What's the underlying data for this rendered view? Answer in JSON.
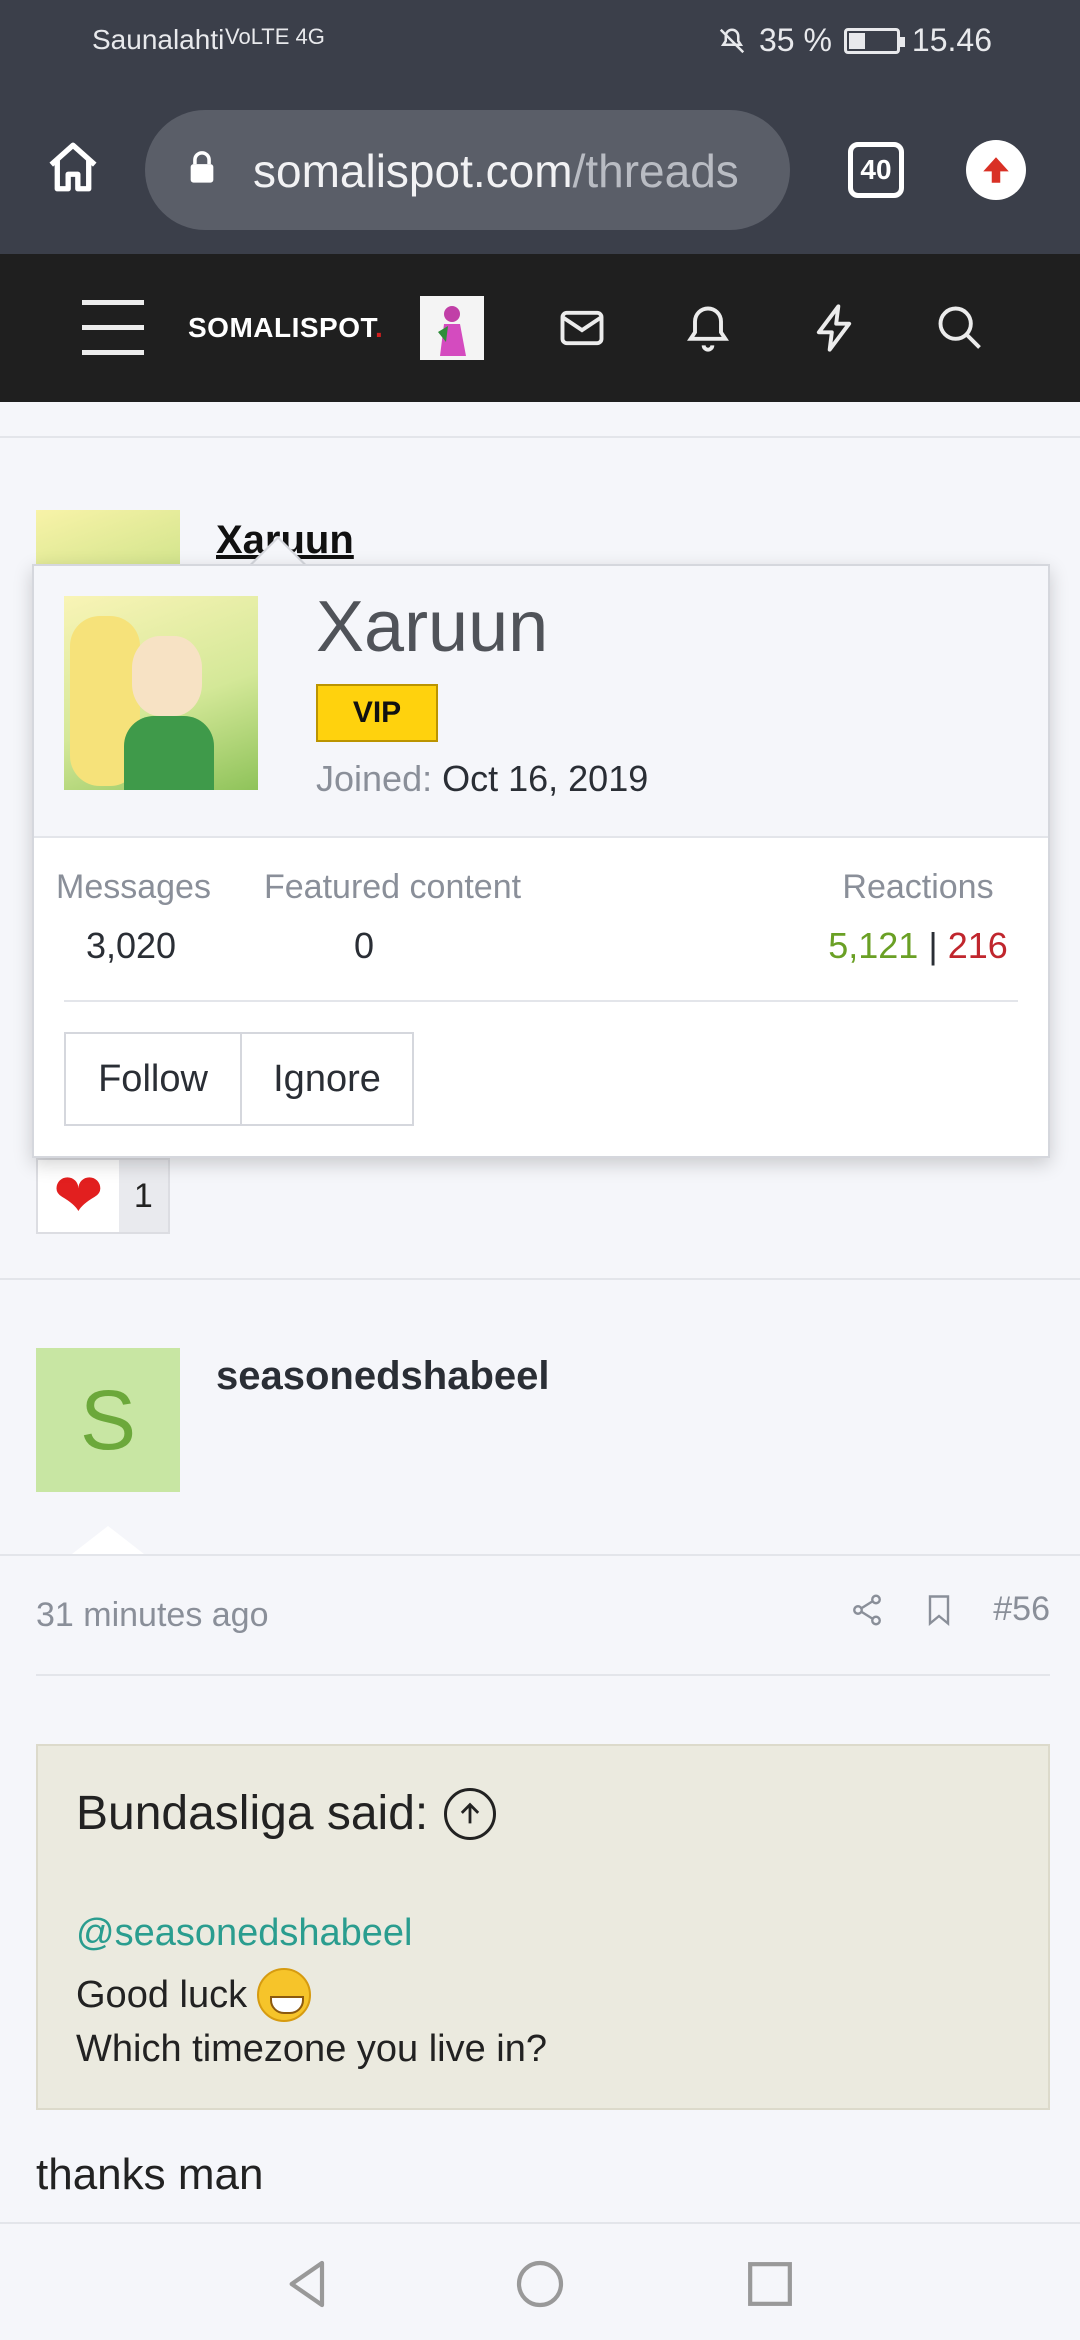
{
  "status_bar": {
    "carrier": "Saunalahti",
    "indicators": "VoLTE 4G",
    "battery": "35 %",
    "battery_level": 0.35,
    "time": "15.46"
  },
  "browser": {
    "url_host": "somalispot.com",
    "url_path": "/threads",
    "tab_count": "40"
  },
  "site_nav": {
    "logo_text": "SOMALISPOT",
    "logo_dot": "."
  },
  "post1": {
    "username": "Xaruun",
    "reaction_count": "1"
  },
  "popup": {
    "name": "Xaruun",
    "badge": "VIP",
    "joined_label": "Joined:",
    "joined_value": "Oct 16, 2019",
    "messages_label": "Messages",
    "messages_value": "3,020",
    "featured_label": "Featured content",
    "featured_value": "0",
    "reactions_label": "Reactions",
    "reactions_pos": "5,121",
    "reactions_sep": " | ",
    "reactions_neg": "216",
    "follow_label": "Follow",
    "ignore_label": "Ignore"
  },
  "post2": {
    "avatar_letter": "S",
    "username": "seasonedshabeel",
    "time": "31 minutes ago",
    "post_number": "#56",
    "quote_author": "Bundasliga said:",
    "quote_mention": "@seasonedshabeel",
    "quote_line1": "Good luck",
    "quote_line2": "Which timezone you live in?",
    "reply_text": "thanks man"
  },
  "colors": {
    "accent_vip": "#ffd20d",
    "positive": "#6aa025",
    "negative": "#c0262d",
    "mention": "#2a9d8f"
  }
}
